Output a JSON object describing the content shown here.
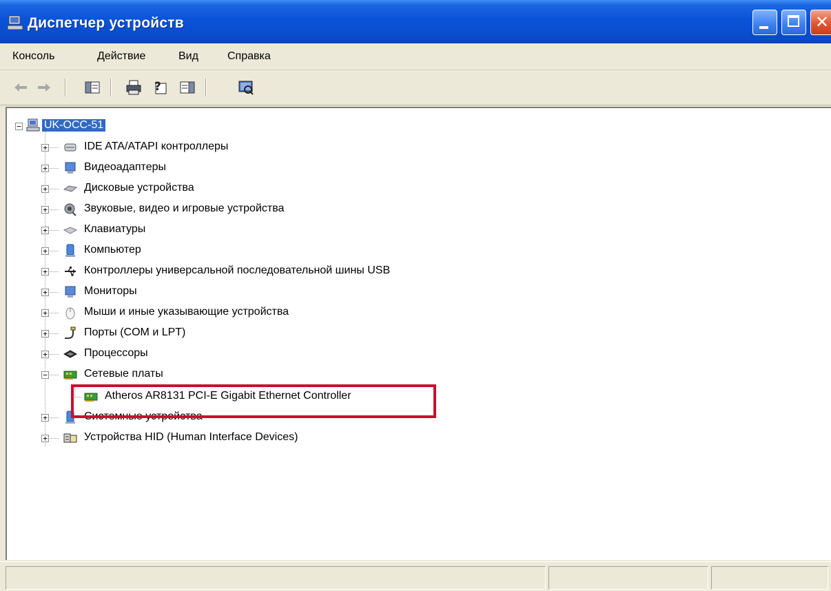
{
  "window": {
    "title": "Диспетчер устройств"
  },
  "menu": {
    "items": [
      "Консоль",
      "Действие",
      "Вид",
      "Справка"
    ]
  },
  "toolbar": {
    "buttons": [
      "back-arrow-icon",
      "forward-arrow-icon",
      "show-hide-console-tree-icon",
      "print-icon",
      "properties-help-icon",
      "action-pane-icon",
      "scan-hardware-icon"
    ]
  },
  "tree": {
    "root": "UK-OCC-51",
    "categories": [
      {
        "label": "IDE ATA/ATAPI контроллеры",
        "icon": "ide-controller-icon",
        "expanded": false
      },
      {
        "label": "Видеоадаптеры",
        "icon": "display-adapter-icon",
        "expanded": false
      },
      {
        "label": "Дисковые устройства",
        "icon": "disk-drive-icon",
        "expanded": false
      },
      {
        "label": "Звуковые, видео и игровые устройства",
        "icon": "sound-device-icon",
        "expanded": false
      },
      {
        "label": "Клавиатуры",
        "icon": "keyboard-icon",
        "expanded": false
      },
      {
        "label": "Компьютер",
        "icon": "computer-icon",
        "expanded": false
      },
      {
        "label": "Контроллеры универсальной последовательной шины USB",
        "icon": "usb-icon",
        "expanded": false
      },
      {
        "label": "Мониторы",
        "icon": "monitor-icon",
        "expanded": false
      },
      {
        "label": "Мыши и иные указывающие устройства",
        "icon": "mouse-icon",
        "expanded": false
      },
      {
        "label": "Порты (COM и LPT)",
        "icon": "port-icon",
        "expanded": false
      },
      {
        "label": "Процессоры",
        "icon": "processor-icon",
        "expanded": false
      },
      {
        "label": "Сетевые платы",
        "icon": "network-card-icon",
        "expanded": true
      },
      {
        "label": "Системные устройства",
        "icon": "system-device-icon",
        "expanded": false
      },
      {
        "label": "Устройства HID (Human Interface Devices)",
        "icon": "hid-device-icon",
        "expanded": false
      }
    ],
    "network_child": "Atheros AR8131 PCI-E Gigabit Ethernet Controller"
  },
  "colors": {
    "title_bar": "#0a53d8",
    "selection": "#316ac5",
    "highlight_box": "#c8102e"
  }
}
